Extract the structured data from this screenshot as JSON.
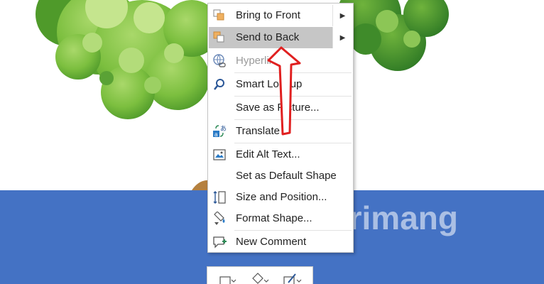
{
  "context_menu": {
    "items": [
      {
        "label": "Bring to Front",
        "icon": "bring-to-front-icon",
        "submenu": true,
        "highlighted": false,
        "disabled": false
      },
      {
        "label": "Send to Back",
        "icon": "send-to-back-icon",
        "submenu": true,
        "highlighted": true,
        "disabled": false
      },
      {
        "label": "Hyperlink",
        "icon": "hyperlink-icon",
        "submenu": false,
        "highlighted": false,
        "disabled": true
      },
      {
        "label": "Smart Lookup",
        "icon": "smart-lookup-icon",
        "submenu": false,
        "highlighted": false,
        "disabled": false
      },
      {
        "label": "Save as Picture...",
        "icon": "",
        "submenu": false,
        "highlighted": false,
        "disabled": false
      },
      {
        "label": "Translate",
        "icon": "translate-icon",
        "submenu": false,
        "highlighted": false,
        "disabled": false
      },
      {
        "label": "Edit Alt Text...",
        "icon": "alt-text-icon",
        "submenu": false,
        "highlighted": false,
        "disabled": false
      },
      {
        "label": "Set as Default Shape",
        "icon": "",
        "submenu": false,
        "highlighted": false,
        "disabled": false
      },
      {
        "label": "Size and Position...",
        "icon": "size-position-icon",
        "submenu": false,
        "highlighted": false,
        "disabled": false
      },
      {
        "label": "Format Shape...",
        "icon": "format-shape-icon",
        "submenu": false,
        "highlighted": false,
        "disabled": false
      },
      {
        "label": "New Comment",
        "icon": "comment-icon",
        "submenu": false,
        "highlighted": false,
        "disabled": false
      }
    ]
  },
  "watermark": {
    "text": "uantrimang"
  },
  "colors": {
    "band": "#4472c4",
    "highlight": "#c6c6c6",
    "arrow": "#e02020"
  }
}
